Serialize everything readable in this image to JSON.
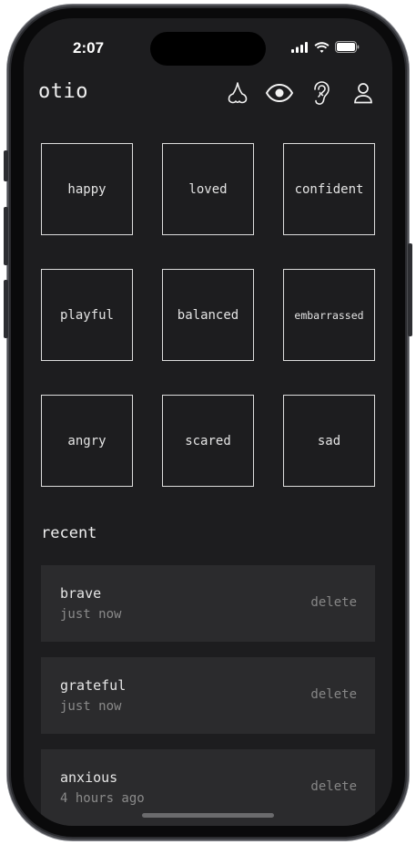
{
  "status_bar": {
    "time": "2:07"
  },
  "app": {
    "title": "otio"
  },
  "header_icons": [
    "nose-icon",
    "eye-icon",
    "ear-icon",
    "profile-icon"
  ],
  "emotions": [
    {
      "label": "happy"
    },
    {
      "label": "loved"
    },
    {
      "label": "confident"
    },
    {
      "label": "playful"
    },
    {
      "label": "balanced"
    },
    {
      "label": "embarrassed"
    },
    {
      "label": "angry"
    },
    {
      "label": "scared"
    },
    {
      "label": "sad"
    }
  ],
  "recent": {
    "heading": "recent",
    "items": [
      {
        "name": "brave",
        "time": "just now",
        "delete_label": "delete"
      },
      {
        "name": "grateful",
        "time": "just now",
        "delete_label": "delete"
      },
      {
        "name": "anxious",
        "time": "4 hours ago",
        "delete_label": "delete"
      }
    ]
  },
  "colors": {
    "background": "#1d1d1f",
    "card": "#2b2b2d",
    "text": "#e6e6e6",
    "muted": "#868686"
  }
}
